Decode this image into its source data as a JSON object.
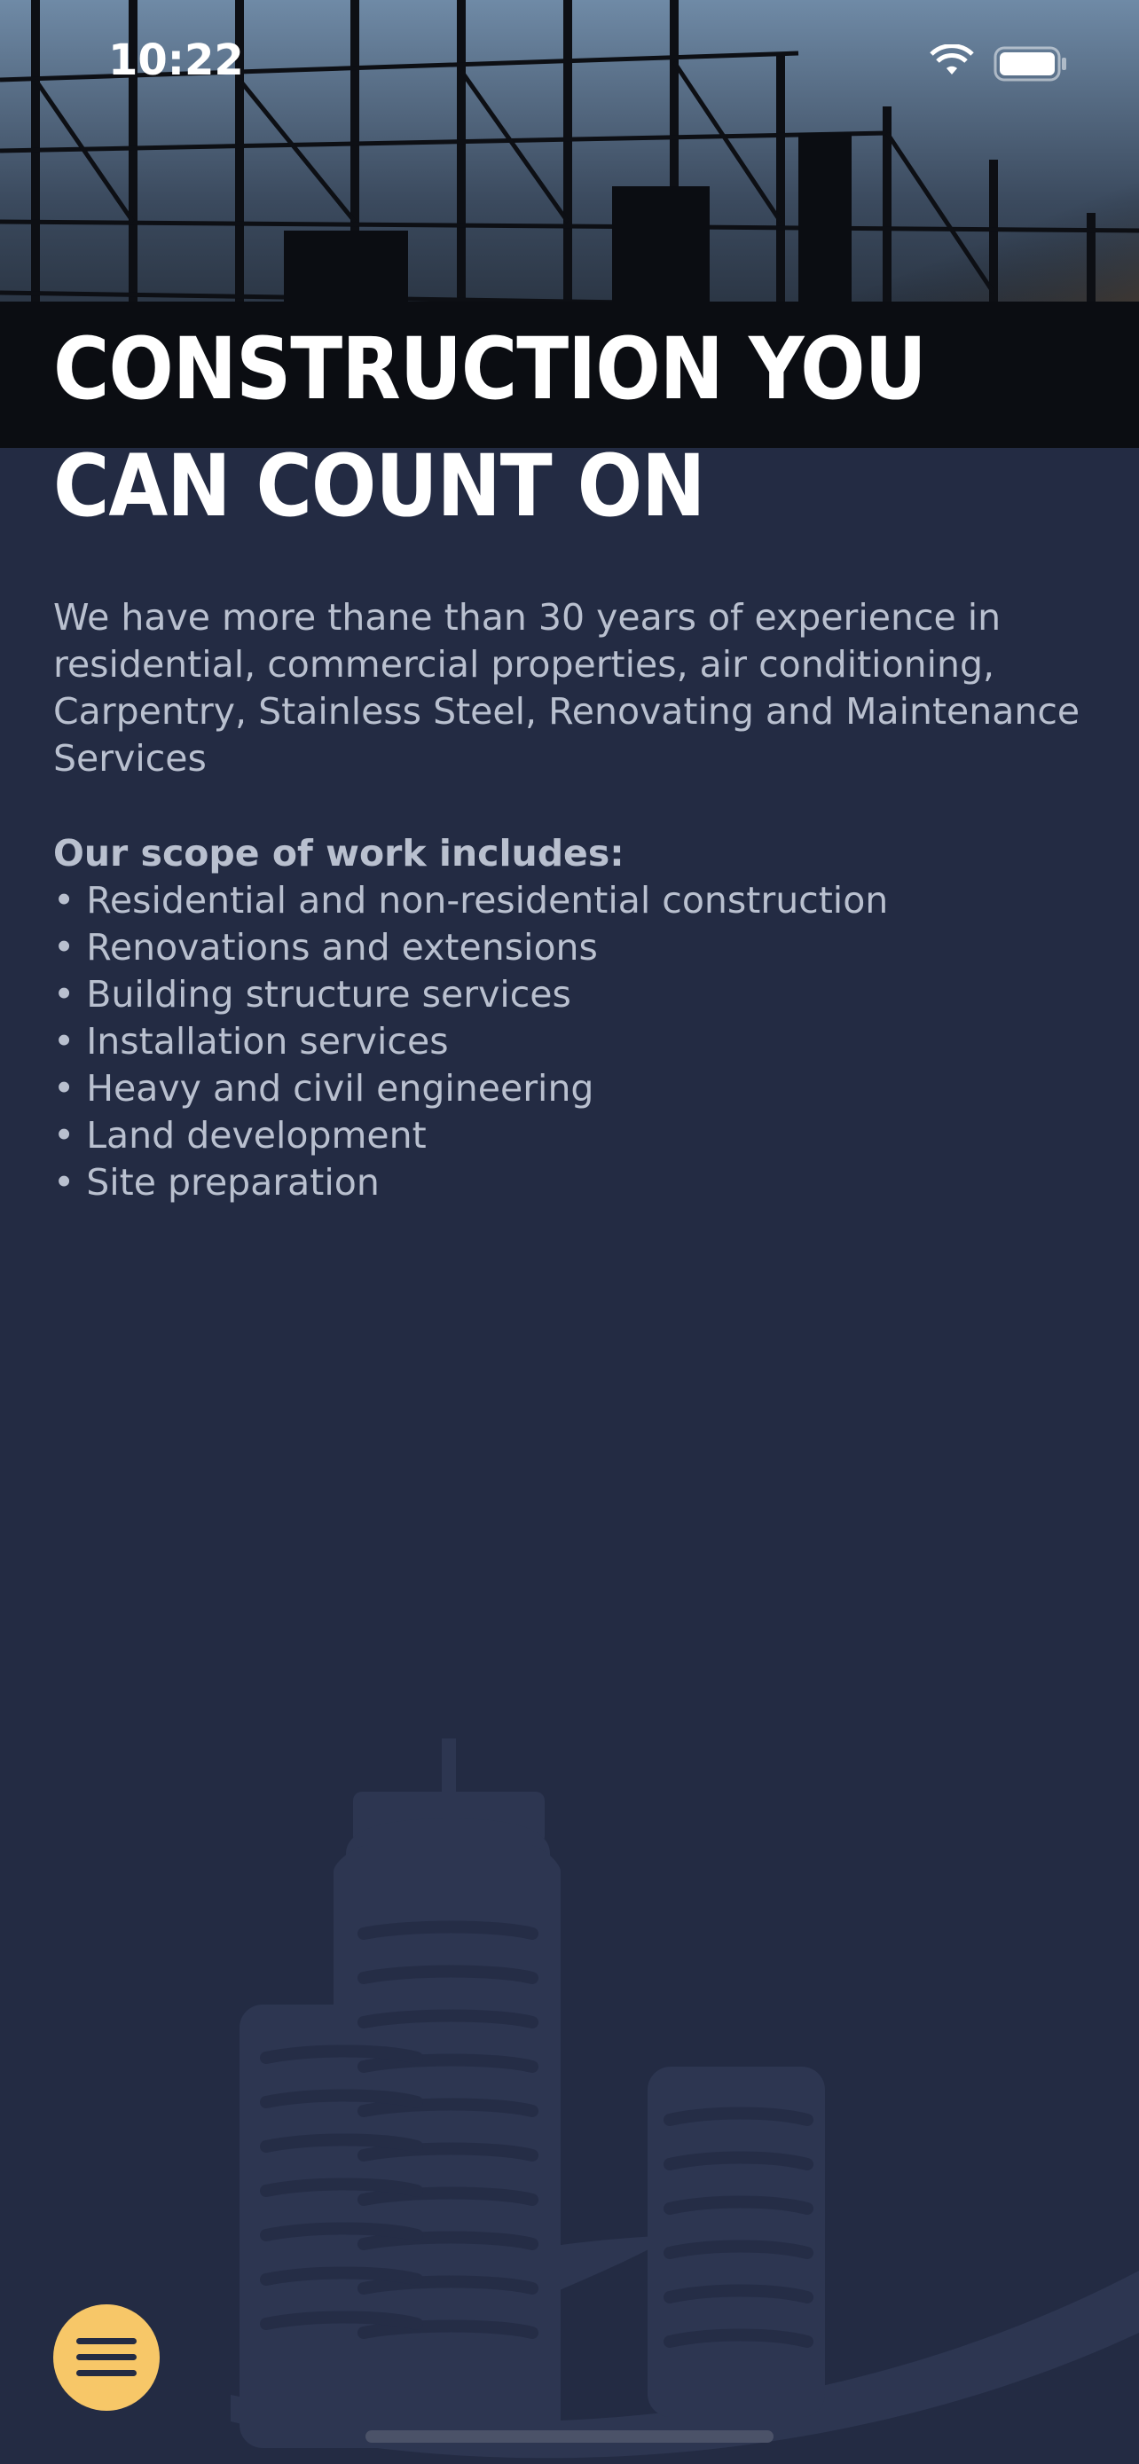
{
  "status_bar": {
    "time": "10:22",
    "icons": [
      "wifi-icon",
      "battery-icon"
    ]
  },
  "hero": {
    "image": "construction-scaffolding-silhouette",
    "headline": "CONSTRUCTION YOU CAN COUNT ON"
  },
  "content": {
    "intro": "We have more thane than 30 years of experience in residential, commercial properties, air conditioning, Carpentry, Stainless Steel, Renovating and Maintenance Services",
    "scope_title": "Our scope of work includes:",
    "scope_items": [
      "Residential and non-residential construction",
      "Renovations and extensions",
      "Building structure services",
      "Installation services",
      "Heavy and civil engineering",
      "Land development",
      "Site preparation"
    ]
  },
  "menu_button": {
    "icon": "hamburger-menu-icon"
  },
  "colors": {
    "background": "#232b43",
    "text": "#b9c0cf",
    "headline": "#ffffff",
    "menu_button": "#f7c768",
    "watermark": "#2d3651"
  }
}
